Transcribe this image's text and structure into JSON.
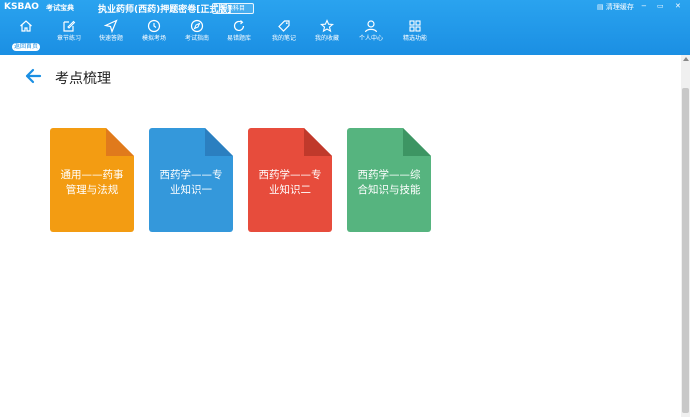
{
  "app": {
    "logo": "KSBAO",
    "logo_sub": "考试宝典",
    "title": "执业药师(西药)押题密卷[正式版]",
    "switch_subject": "切换科目",
    "window_controls": {
      "clear_cache": "清理缓存",
      "minimize": "−",
      "restore": "▭",
      "close": "✕"
    }
  },
  "nav": [
    {
      "label": "返回首页",
      "icon": "home-icon",
      "active": true
    },
    {
      "label": "章节练习",
      "icon": "edit-icon",
      "active": false
    },
    {
      "label": "快速答题",
      "icon": "send-icon",
      "active": false
    },
    {
      "label": "模拟考场",
      "icon": "clock-icon",
      "active": false
    },
    {
      "label": "考试指南",
      "icon": "compass-icon",
      "active": false
    },
    {
      "label": "易错题库",
      "icon": "refresh-icon",
      "active": false
    },
    {
      "label": "我的笔记",
      "icon": "tag-icon",
      "active": false
    },
    {
      "label": "我的收藏",
      "icon": "star-icon",
      "active": false
    },
    {
      "label": "个人中心",
      "icon": "user-icon",
      "active": false
    },
    {
      "label": "精选功能",
      "icon": "grid-icon",
      "active": false
    }
  ],
  "page": {
    "title": "考点梳理",
    "back_icon": "arrow-left-icon"
  },
  "cards": [
    {
      "label": "通用——药事管理与法规",
      "color": "#f39c12",
      "fold": "#e07a1c"
    },
    {
      "label": "西药学——专业知识一",
      "color": "#3498db",
      "fold": "#2b7fc0"
    },
    {
      "label": "西药学——专业知识二",
      "color": "#e74c3c",
      "fold": "#c0392b"
    },
    {
      "label": "西药学——综合知识与技能",
      "color": "#56b47f",
      "fold": "#3d9563"
    }
  ]
}
